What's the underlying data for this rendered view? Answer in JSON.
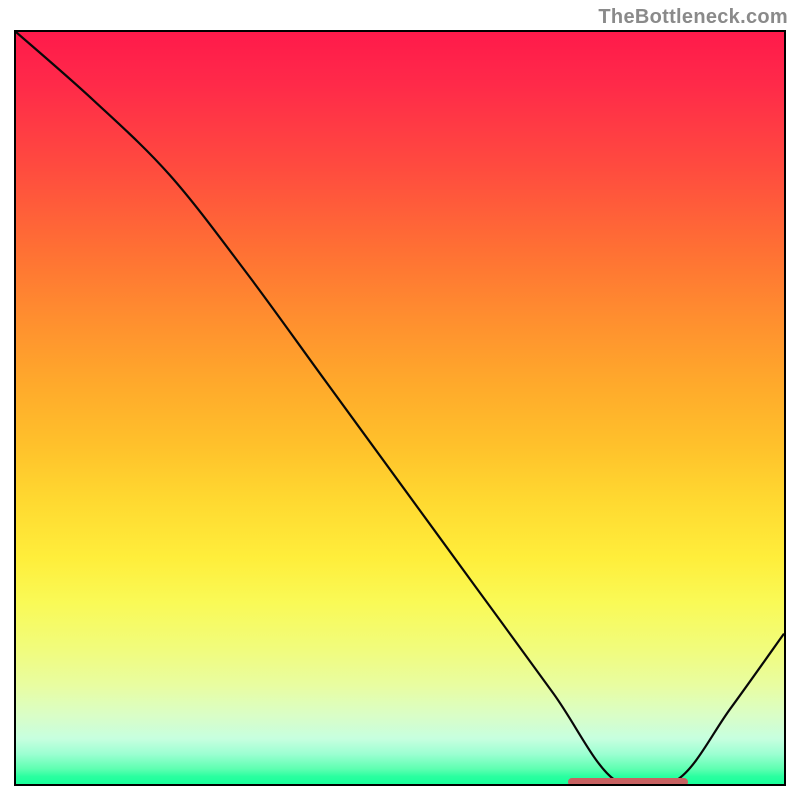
{
  "watermark": "TheBottleneck.com",
  "colors": {
    "curve_stroke": "#080808",
    "marker_fill": "#c86262",
    "border": "#000000"
  },
  "chart_data": {
    "type": "line",
    "title": "",
    "xlabel": "",
    "ylabel": "",
    "xlim": [
      0,
      100
    ],
    "ylim": [
      0,
      100
    ],
    "grid": false,
    "legend": false,
    "x": [
      0,
      10,
      20,
      30,
      40,
      50,
      60,
      70,
      78,
      86,
      93,
      100
    ],
    "values": [
      100.0,
      91.0,
      81.0,
      68.0,
      54.0,
      40.0,
      26.0,
      12.0,
      0.5,
      0.5,
      10.0,
      20.0
    ],
    "marker": {
      "x_start": 71.5,
      "x_end": 87.0,
      "y": 0.8
    }
  }
}
